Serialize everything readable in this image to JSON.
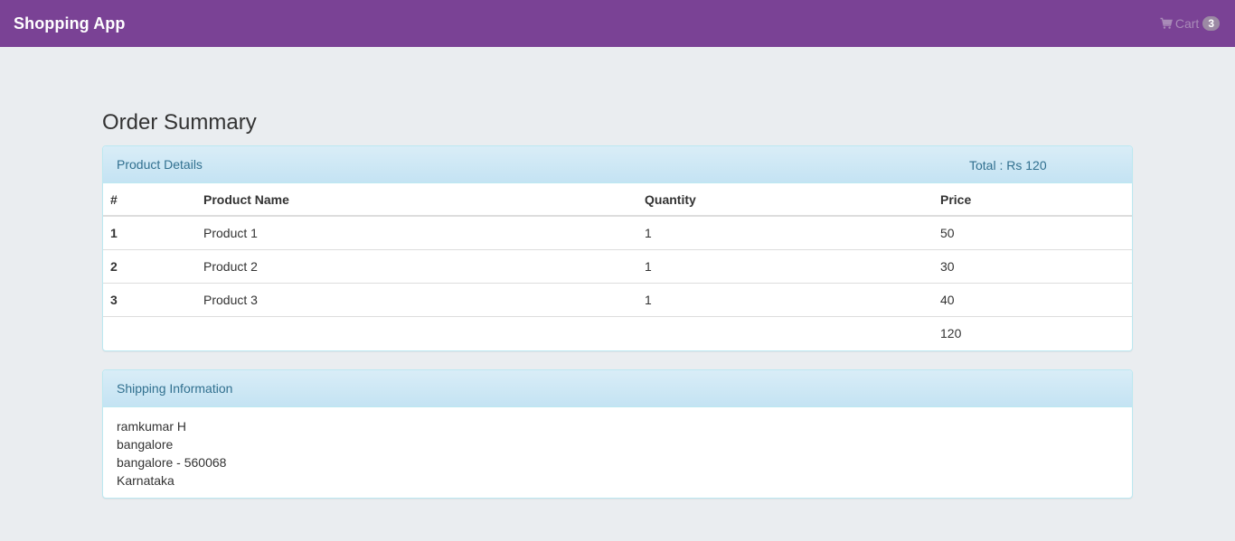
{
  "navbar": {
    "brand": "Shopping App",
    "cart_label": "Cart",
    "cart_count": "3"
  },
  "page_title": "Order Summary",
  "product_panel": {
    "heading": "Product Details",
    "total": "Total : Rs 120",
    "columns": [
      "#",
      "Product Name",
      "Quantity",
      "Price"
    ],
    "rows": [
      {
        "num": "1",
        "name": "Product 1",
        "qty": "1",
        "price": "50"
      },
      {
        "num": "2",
        "name": "Product 2",
        "qty": "1",
        "price": "30"
      },
      {
        "num": "3",
        "name": "Product 3",
        "qty": "1",
        "price": "40"
      }
    ],
    "grand_total": "120"
  },
  "shipping_panel": {
    "heading": "Shipping Information",
    "lines": [
      "ramkumar H",
      "bangalore",
      "bangalore - 560068",
      "Karnataka"
    ]
  },
  "colors": {
    "navbar": "#7a4295",
    "background": "#eaedf0",
    "panel_heading": "#d9edf7",
    "panel_heading_text": "#31708f"
  },
  "icons": {
    "cart": "shopping-cart-icon"
  }
}
